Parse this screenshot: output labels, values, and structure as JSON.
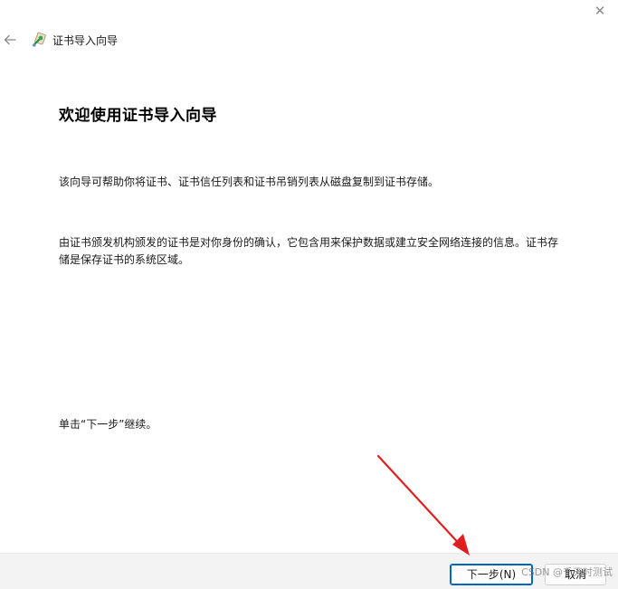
{
  "window": {
    "close_label": "✕"
  },
  "header": {
    "back_icon": "arrow-left-icon",
    "app_icon": "certificate-wizard-icon",
    "title": "证书导入向导"
  },
  "main": {
    "heading": "欢迎使用证书导入向导",
    "paragraph1": "该向导可帮助你将证书、证书信任列表和证书吊销列表从磁盘复制到证书存储。",
    "paragraph2": "由证书颁发机构颁发的证书是对你身份的确认，它包含用来保护数据或建立安全网络连接的信息。证书存储是保存证书的系统区域。",
    "paragraph3": "单击“下一步”继续。"
  },
  "footer": {
    "next_label": "下一步(N)",
    "cancel_label": "取消"
  },
  "watermark": {
    "text": "CSDN @千天时测试"
  },
  "colors": {
    "accent": "#0067c0",
    "footer_bg": "#f3f3f3",
    "annotation_arrow": "#e02020"
  }
}
